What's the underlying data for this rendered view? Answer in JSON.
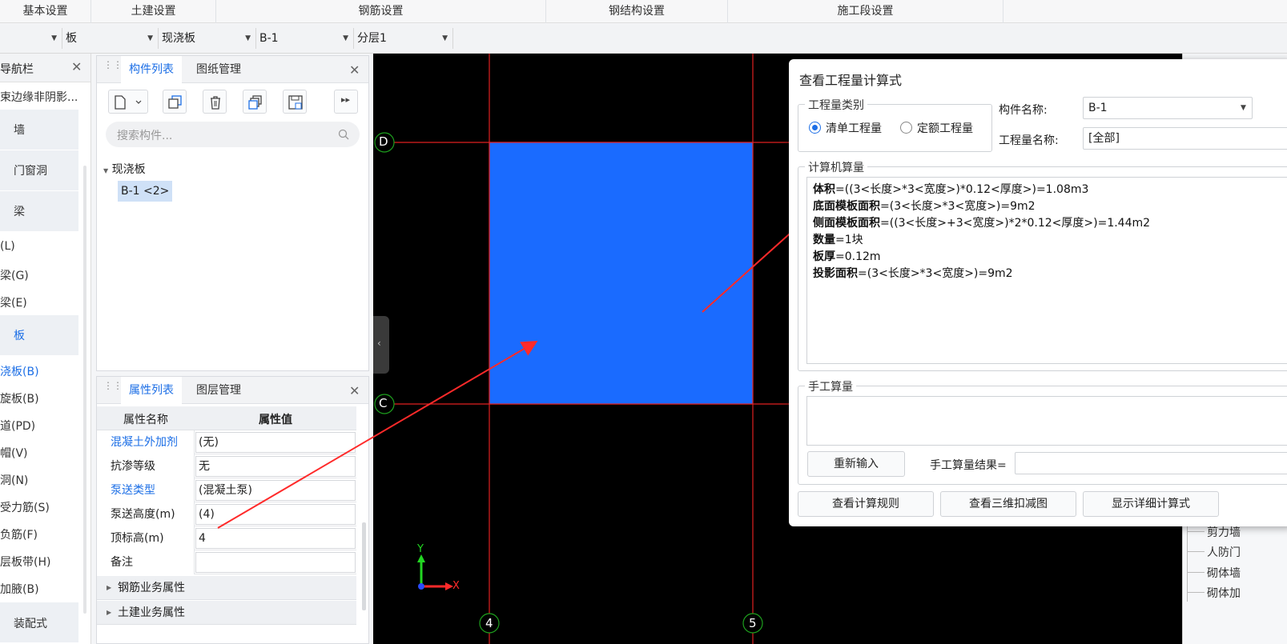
{
  "top_tabs": [
    "基本设置",
    "土建设置",
    "钢筋设置",
    "钢结构设置",
    "施工段设置"
  ],
  "filters": {
    "first": "",
    "type": "板",
    "subtype": "现浇板",
    "component": "B-1",
    "layer": "分层1"
  },
  "nav": {
    "title": "导航栏",
    "top_item": "束边缘非阴影...",
    "categories": [
      "墙",
      "门窗洞",
      "梁",
      "板",
      "装配式"
    ],
    "items": [
      "(L)",
      "梁(G)",
      "梁(E)",
      "浇板(B)",
      "旋板(B)",
      "道(PD)",
      "帽(V)",
      "洞(N)",
      "受力筋(S)",
      "负筋(F)",
      "层板带(H)",
      "加腋(B)"
    ]
  },
  "component_panel": {
    "tabs": [
      "构件列表",
      "图纸管理"
    ],
    "search_placeholder": "搜索构件...",
    "tree_group": "现浇板",
    "tree_item": "B-1 <2>"
  },
  "property_panel": {
    "tabs": [
      "属性列表",
      "图层管理"
    ],
    "col_name": "属性名称",
    "col_value": "属性值",
    "rows": [
      {
        "name": "混凝土外加剂",
        "value": "(无)"
      },
      {
        "name": "抗渗等级",
        "value": "无"
      },
      {
        "name": "泵送类型",
        "value": "(混凝土泵)"
      },
      {
        "name": "泵送高度(m)",
        "value": "(4)"
      },
      {
        "name": "顶标高(m)",
        "value": "4"
      },
      {
        "name": "备注",
        "value": ""
      }
    ],
    "groups": [
      "钢筋业务属性",
      "土建业务属性"
    ]
  },
  "canvas": {
    "axis_labels": {
      "top": "D",
      "middle": "C",
      "left_col": "4",
      "right_col": "5"
    },
    "axis_x": "X",
    "axis_y": "Y",
    "slab_color": "#1a6bff"
  },
  "dialog": {
    "title": "查看工程量计算式",
    "category_legend": "工程量类别",
    "radio1": "清单工程量",
    "radio2": "定额工程量",
    "component_name_label": "构件名称:",
    "component_name_value": "B-1",
    "quantity_name_label": "工程量名称:",
    "quantity_name_value": "[全部]",
    "computer_legend": "计算机算量",
    "formulas": [
      {
        "name": "体积",
        "expr": "=((3<长度>*3<宽度>)*0.12<厚度>)=1.08m3"
      },
      {
        "name": "底面模板面积",
        "expr": "=(3<长度>*3<宽度>)=9m2"
      },
      {
        "name": "侧面模板面积",
        "expr": "=((3<长度>+3<宽度>)*2*0.12<厚度>)=1.44m2"
      },
      {
        "name": "数量",
        "expr": "=1块"
      },
      {
        "name": "板厚",
        "expr": "=0.12m"
      },
      {
        "name": "投影面积",
        "expr": "=(3<长度>*3<宽度>)=9m2"
      }
    ],
    "manual_legend": "手工算量",
    "reinput_button": "重新输入",
    "manual_result_label": "手工算量结果=",
    "buttons": [
      "查看计算规则",
      "查看三维扣减图",
      "显示详细计算式"
    ]
  },
  "right_panel": {
    "items": [
      "剪力墙",
      "人防门",
      "砌体墙",
      "砌体加"
    ]
  }
}
